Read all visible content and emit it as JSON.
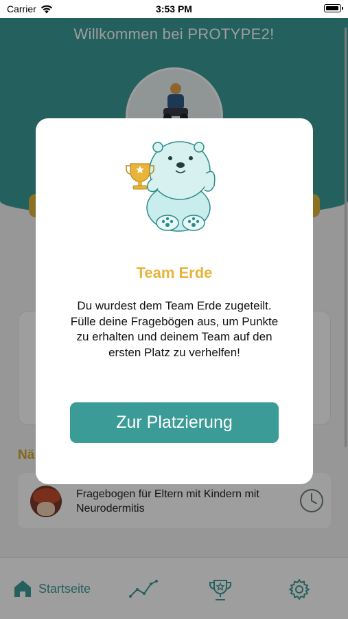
{
  "status_bar": {
    "carrier": "Carrier",
    "time": "3:53 PM"
  },
  "header": {
    "welcome": "Willkommen bei PROTYPE2!"
  },
  "next_section": {
    "title": "Nä"
  },
  "questionnaire": {
    "title": "Fragebogen für Eltern mit Kindern mit Neurodermitis"
  },
  "tabbar": {
    "items": [
      {
        "label": "Startseite",
        "icon": "home-icon",
        "active": true
      },
      {
        "label": "",
        "icon": "chart-icon",
        "active": false
      },
      {
        "label": "",
        "icon": "trophy-icon",
        "active": false
      },
      {
        "label": "",
        "icon": "gear-icon",
        "active": false
      }
    ]
  },
  "modal": {
    "team_name": "Team Erde",
    "message": "Du wurdest dem Team Erde zugeteilt. Fülle deine Fragebögen aus, um Punkte zu erhalten und deinem Team auf den ersten Platz zu verhelfen!",
    "button_label": "Zur Platzierung",
    "illustration": "polar-bear-with-trophy"
  },
  "colors": {
    "primary_teal": "#3b9b97",
    "accent_gold": "#e8b43c",
    "overlay": "rgba(0,0,0,0.38)"
  }
}
